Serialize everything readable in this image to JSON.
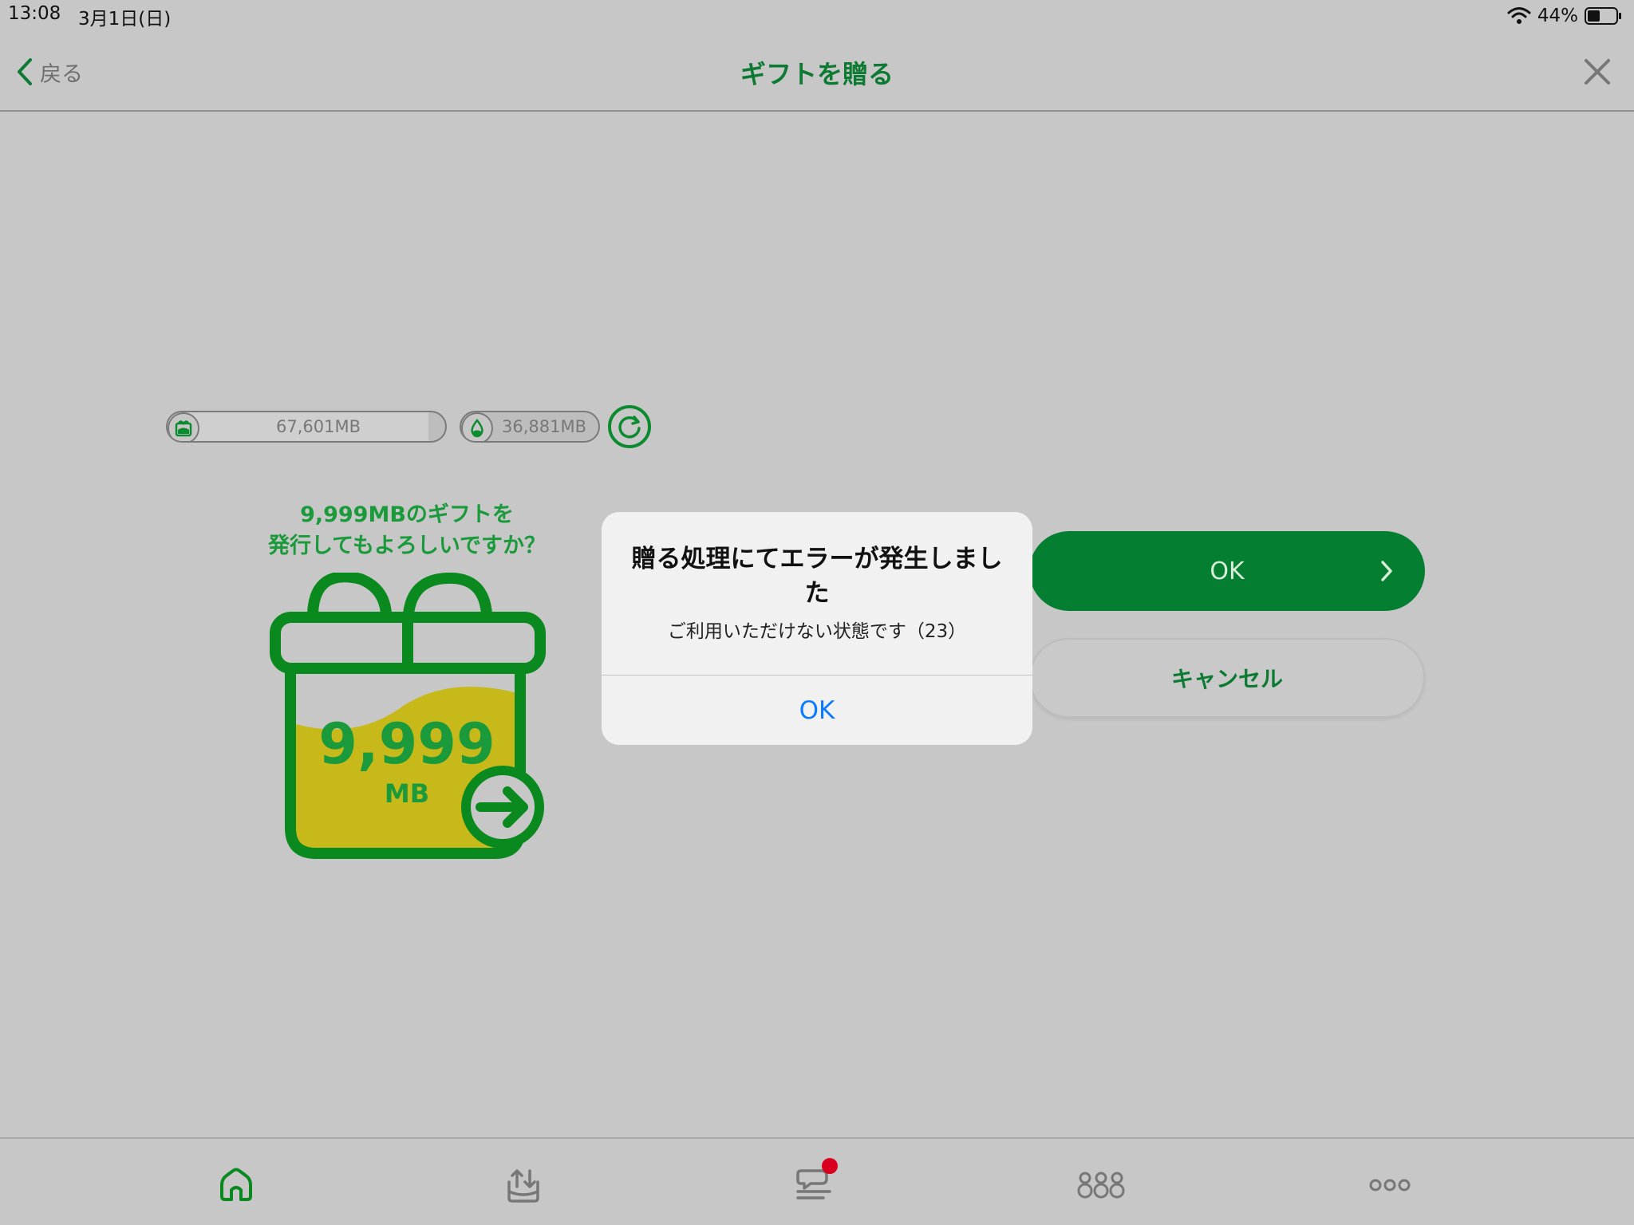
{
  "status_bar": {
    "time": "13:08",
    "date": "3月1日(日)",
    "battery_percent": "44%",
    "battery_level": 0.44
  },
  "nav": {
    "back_label": "戻る",
    "title": "ギフトを贈る",
    "close_icon": "close-icon"
  },
  "usage": {
    "primary": {
      "value": "67,601MB",
      "icon": "gift-box-icon",
      "fill_fraction": 0.94
    },
    "secondary": {
      "value": "36,881MB",
      "icon": "droplet-icon",
      "fill_fraction": 0.0
    },
    "refresh_icon": "refresh-icon"
  },
  "gift": {
    "question_line1": "9,999MBのギフトを",
    "question_line2": "発行してもよろしいですか？",
    "amount": "9,999",
    "unit": "MB"
  },
  "actions": {
    "ok_label": "OK",
    "cancel_label": "キャンセル"
  },
  "alert": {
    "title": "贈る処理にてエラーが発生しました",
    "message": "ご利用いただけない状態です（23）",
    "ok_label": "OK"
  },
  "tabs": [
    {
      "icon": "home-icon",
      "active": true
    },
    {
      "icon": "tray-upload-icon",
      "active": false
    },
    {
      "icon": "chat-icon",
      "active": false,
      "badge": true
    },
    {
      "icon": "group-icon",
      "active": false
    },
    {
      "icon": "more-icon",
      "active": false
    }
  ],
  "colors": {
    "brand_green": "#047f31",
    "text_green": "#1a9a3a",
    "gift_fill": "#c8b91a",
    "alert_link": "#0a7aff",
    "badge_red": "#d8001e",
    "background": "#c7c7c7"
  }
}
